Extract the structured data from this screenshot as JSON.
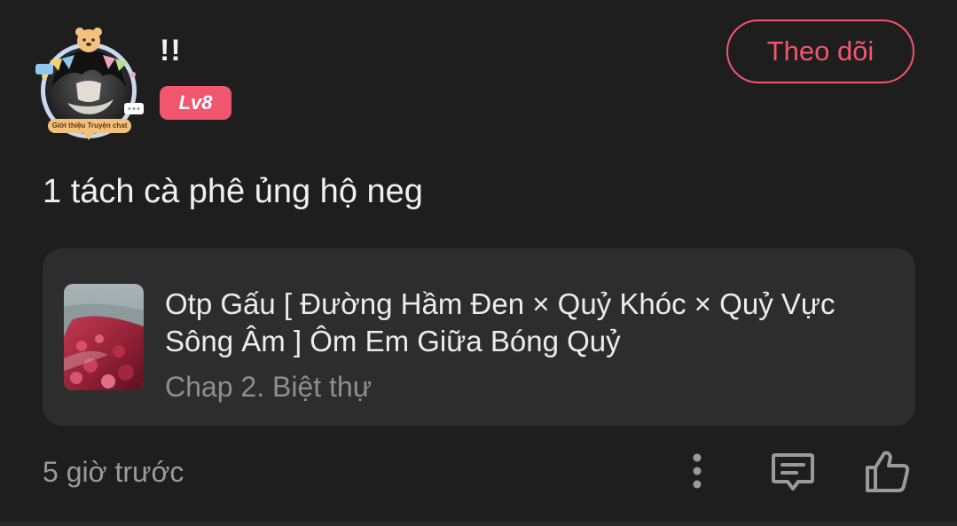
{
  "comment": {
    "username": "!!",
    "level": "Lv8",
    "avatar_tag": "Giới thiệu Truyện chat",
    "follow_label": "Theo dõi",
    "text": "1 tách cà phê ủng hộ neg",
    "timestamp": "5 giờ trước"
  },
  "story": {
    "title": "Otp Gấu [ Đường Hầm Đen × Quỷ Khóc × Quỷ Vực Sông Âm ] Ôm Em Giữa Bóng Quỷ",
    "chapter": "Chap 2. Biệt thự"
  },
  "icons": {
    "more": "more-vertical-icon",
    "reply": "message-square-icon",
    "like": "thumbs-up-icon"
  },
  "colors": {
    "background": "#1e1e1e",
    "card": "#2d2d2d",
    "accent": "#f0566e",
    "secondary_text": "#9a9a9a"
  }
}
